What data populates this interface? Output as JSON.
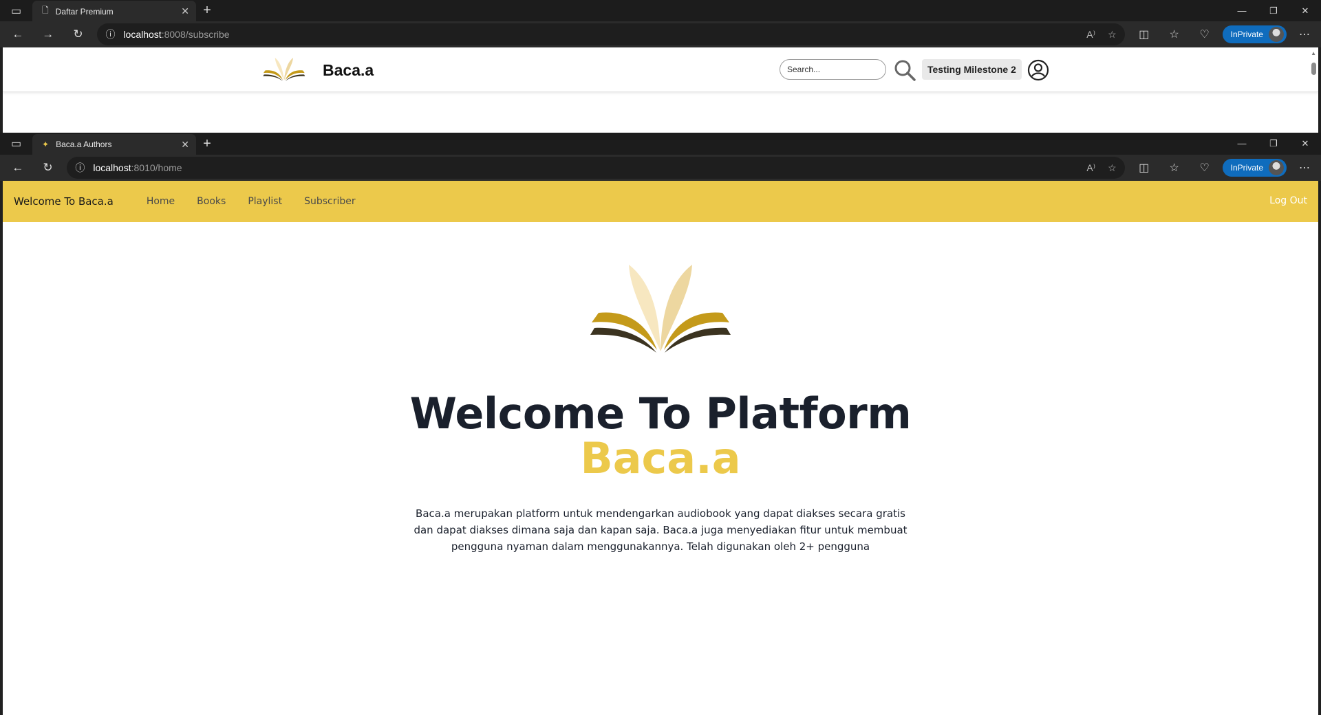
{
  "window1": {
    "tab_title": "Daftar Premium",
    "url_host": "localhost",
    "url_path": ":8008/subscribe",
    "inprivate_label": "InPrivate",
    "page": {
      "site_title": "Baca.a",
      "search_placeholder": "Search...",
      "user_name": "Testing Milestone 2"
    }
  },
  "window2": {
    "tab_title": "Baca.a Authors",
    "url_host": "localhost",
    "url_path": ":8010/home",
    "inprivate_label": "InPrivate",
    "page": {
      "brand": "Welcome To Baca.a",
      "nav": [
        "Home",
        "Books",
        "Playlist",
        "Subscriber"
      ],
      "logout": "Log Out",
      "hero_title": "Welcome To Platform",
      "hero_subtitle": "Baca.a",
      "hero_description": "Baca.a merupakan platform untuk mendengarkan audiobook yang dapat diakses secara gratis dan dapat diakses dimana saja dan kapan saja. Baca.a juga menyediakan fitur untuk membuat pengguna nyaman dalam menggunakannya. Telah digunakan oleh 2+ pengguna"
    }
  },
  "colors": {
    "accent": "#ecc94b",
    "inprivate": "#0f6cbd",
    "heading": "#1a202c"
  }
}
